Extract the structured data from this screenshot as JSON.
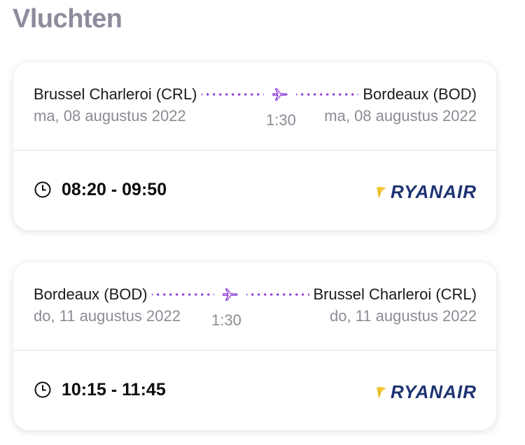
{
  "page": {
    "title": "Vluchten"
  },
  "flights": [
    {
      "from": "Brussel Charleroi (CRL)",
      "to": "Bordeaux (BOD)",
      "departure_date": "ma, 08 augustus 2022",
      "arrival_date": "ma, 08 augustus 2022",
      "duration": "1:30",
      "time_range": "08:20 - 09:50",
      "airline": "RYANAIR"
    },
    {
      "from": "Bordeaux (BOD)",
      "to": "Brussel Charleroi (CRL)",
      "departure_date": "do, 11 augustus 2022",
      "arrival_date": "do, 11 augustus 2022",
      "duration": "1:30",
      "time_range": "10:15 - 11:45",
      "airline": "RYANAIR"
    }
  ],
  "icons": {
    "plane": "plane-icon",
    "clock": "clock-icon",
    "airline_logo": "ryanair-harp-icon"
  },
  "colors": {
    "title": "#8f8b9d",
    "route_accent": "#8f3fd6",
    "secondary_text": "#8b8b95",
    "airline_brand": "#1e3373",
    "airline_logo_accent": "#f1c933"
  }
}
